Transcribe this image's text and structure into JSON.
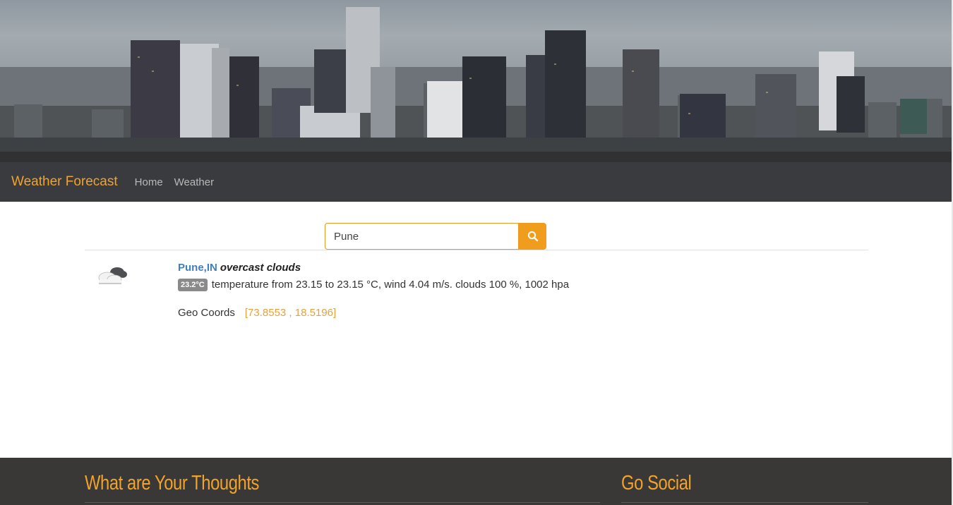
{
  "navbar": {
    "brand": "Weather Forecast",
    "links": [
      "Home",
      "Weather"
    ]
  },
  "search": {
    "value": "Pune",
    "button_icon": "search-icon"
  },
  "result": {
    "icon": "overcast-clouds-icon",
    "city": "Pune,IN",
    "description": "overcast clouds",
    "temperature_badge": "23.2°C",
    "details": "temperature from 23.15 to 23.15 °C, wind 4.04 m/s. clouds 100 %, 1002 hpa",
    "geo_label": "Geo Coords",
    "geo_value": "[73.8553 , 18.5196]"
  },
  "footer": {
    "left_title": "What are Your Thoughts",
    "right_title": "Go Social"
  },
  "colors": {
    "accent": "#f1a32a",
    "navbar_bg": "#3a3b3f",
    "footer_bg": "#393836",
    "link_blue": "#3f7fc0"
  }
}
